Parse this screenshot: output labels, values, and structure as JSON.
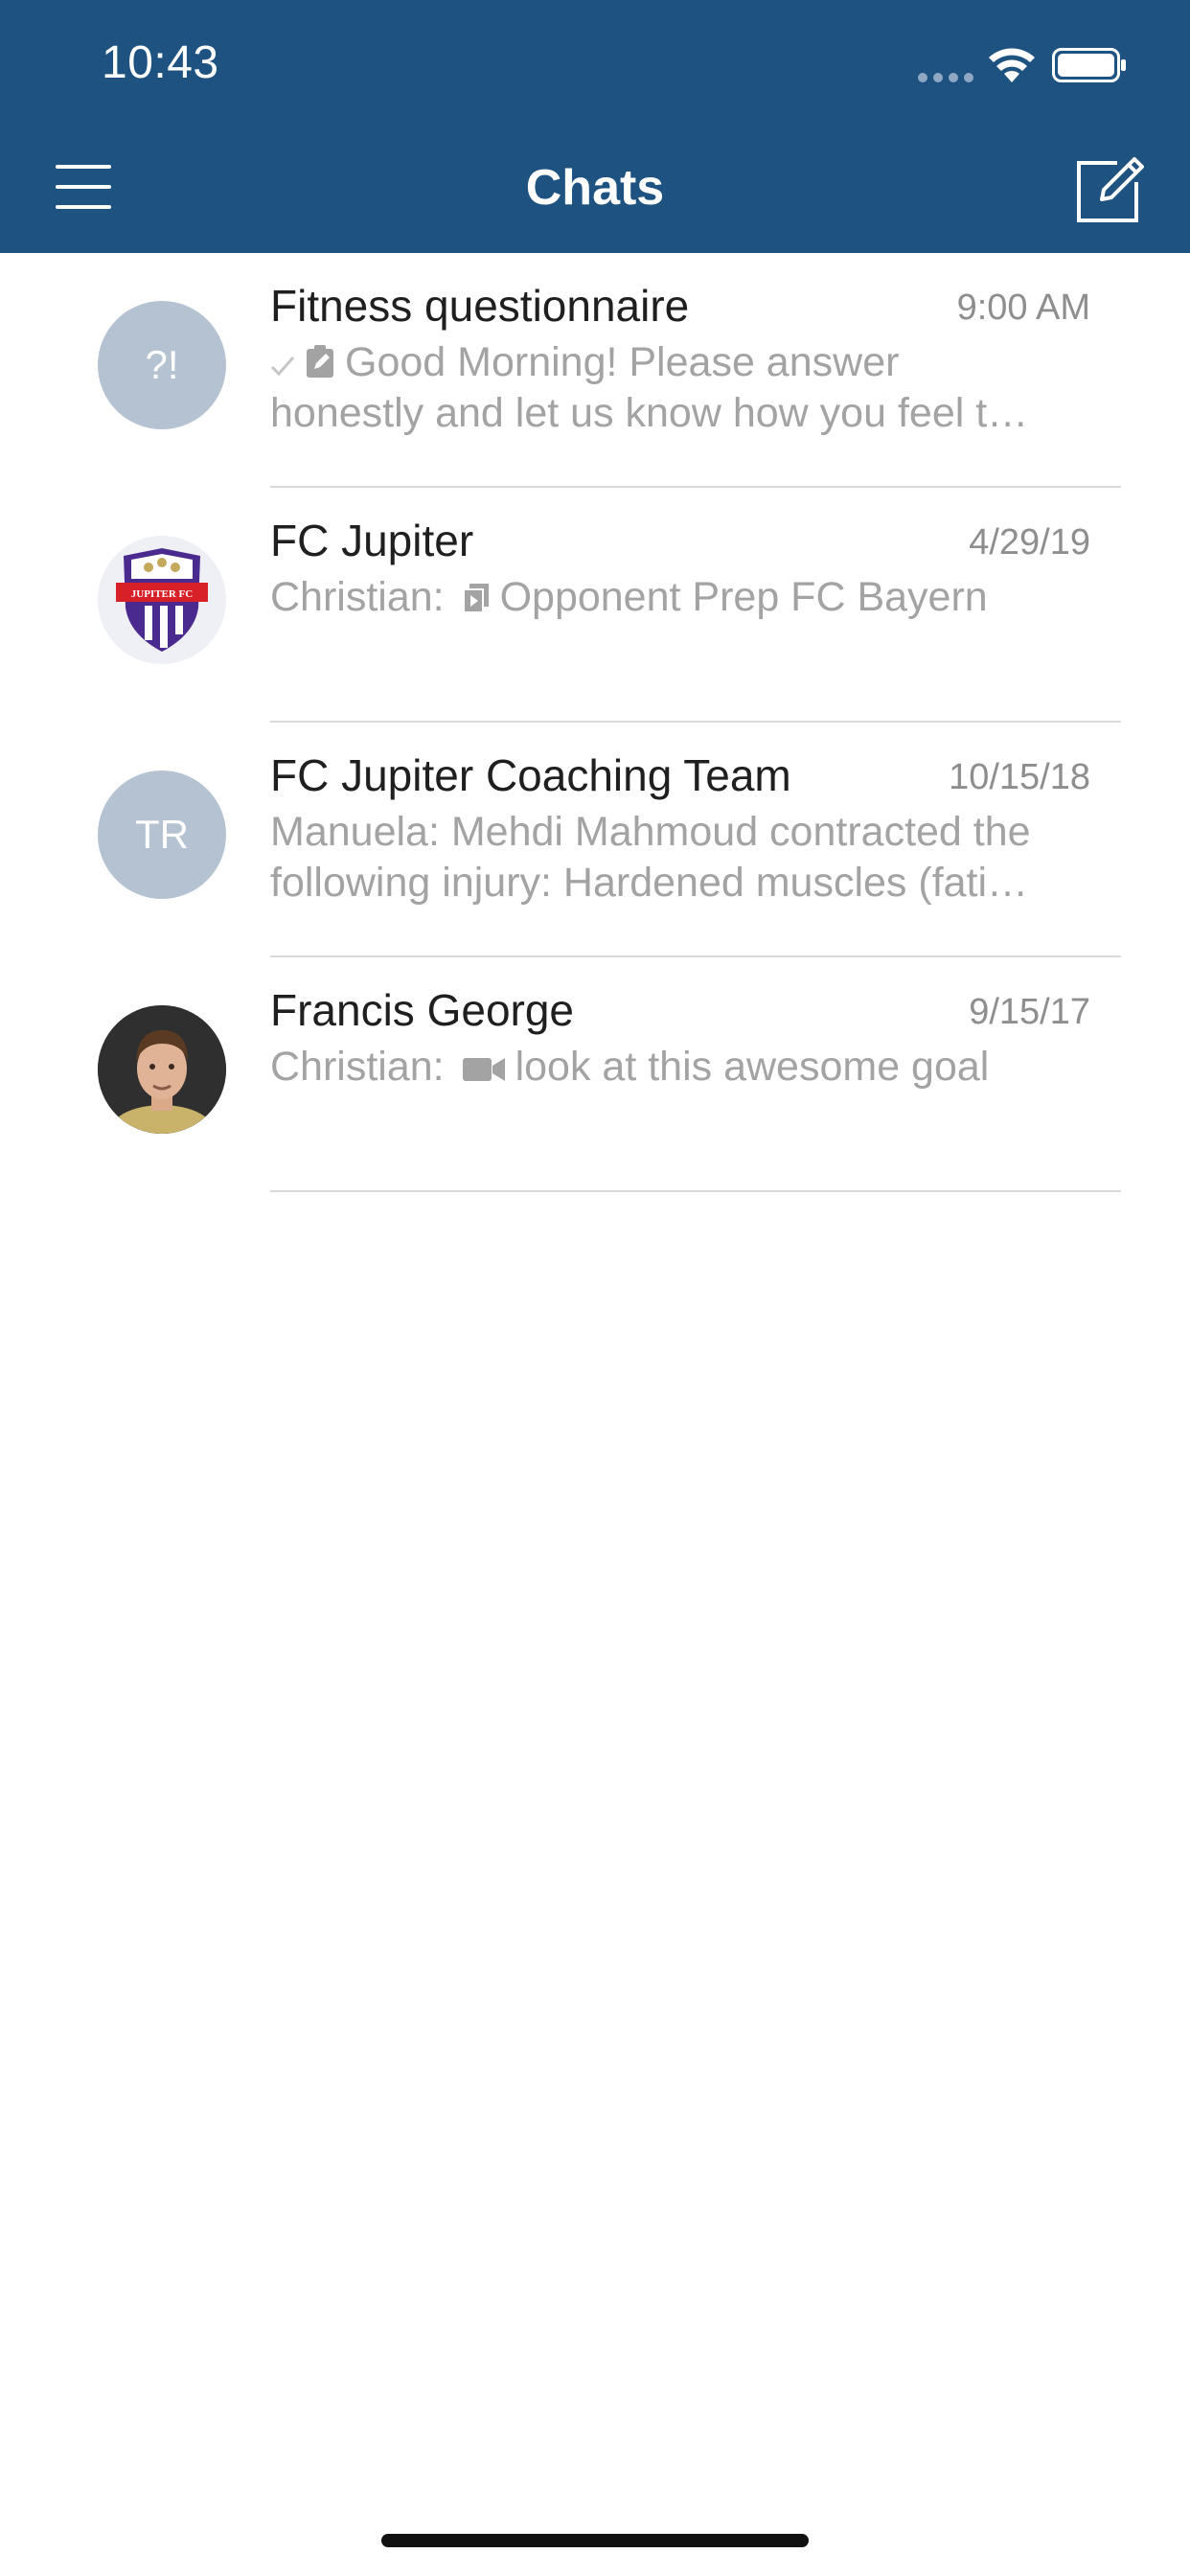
{
  "status_bar": {
    "time": "10:43"
  },
  "header": {
    "title": "Chats",
    "menu_icon": "hamburger-menu-icon",
    "compose_icon": "compose-icon",
    "background_color": "#1e5281"
  },
  "chats": [
    {
      "name": "Fitness questionnaire",
      "time": "9:00 AM",
      "avatar_text": "?!",
      "preview_line1": "Good Morning! Please answer",
      "preview_line2": "honestly and let us know how you feel t…",
      "preview_icons": [
        "checkmark-icon",
        "clipboard-icon"
      ]
    },
    {
      "name": "FC Jupiter",
      "time": "4/29/19",
      "avatar_logo_text": "JUPITER FC",
      "preview_sender": "Christian:",
      "preview_line1": "Opponent Prep FC Bayern",
      "preview_icons": [
        "document-icon"
      ]
    },
    {
      "name": "FC Jupiter Coaching Team",
      "time": "10/15/18",
      "avatar_text": "TR",
      "preview_line1": "Manuela: Mehdi Mahmoud contracted the",
      "preview_line2": "following injury: Hardened muscles (fati…"
    },
    {
      "name": "Francis George",
      "time": "9/15/17",
      "preview_sender": "Christian:",
      "preview_line1": "look at this awesome goal",
      "preview_icons": [
        "video-camera-icon"
      ]
    }
  ]
}
